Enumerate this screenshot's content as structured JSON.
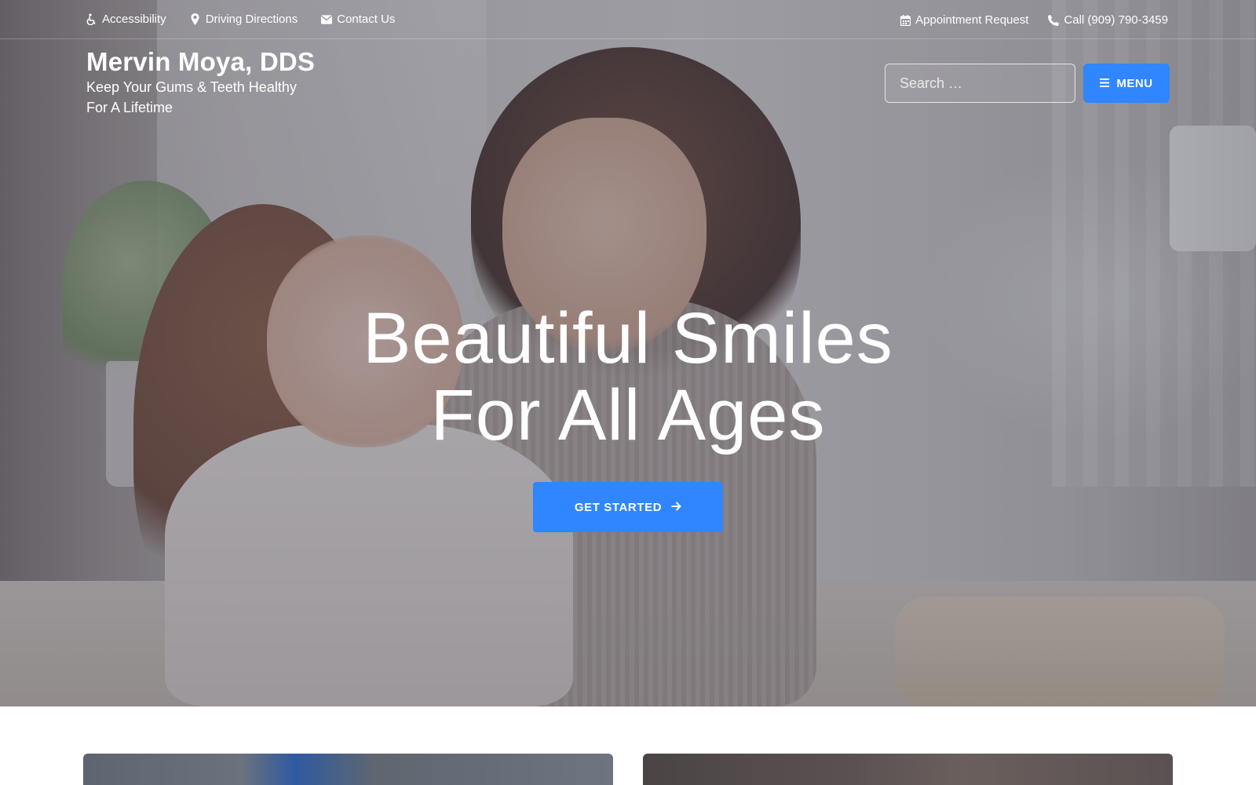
{
  "topbar": {
    "accessibility": "Accessibility",
    "directions": "Driving Directions",
    "contact": "Contact Us",
    "appointment": "Appointment Request",
    "call": "Call (909) 790-3459"
  },
  "brand": {
    "name": "Mervin Moya, DDS",
    "tagline_line1": "Keep Your Gums & Teeth Healthy",
    "tagline_line2": "For A Lifetime"
  },
  "search": {
    "placeholder": "Search …"
  },
  "menu": {
    "label": "MENU"
  },
  "hero": {
    "headline_line1": "Beautiful Smiles",
    "headline_line2": "For All Ages",
    "cta_label": "GET STARTED"
  },
  "icons": {
    "accessibility": "wheelchair-icon",
    "directions": "map-marker-icon",
    "contact": "envelope-icon",
    "appointment": "calendar-icon",
    "call": "phone-icon",
    "search": "search-icon",
    "menu": "hamburger-icon",
    "cta": "arrow-right-icon"
  },
  "colors": {
    "accent": "#2f86ff",
    "text": "#ffffff"
  }
}
